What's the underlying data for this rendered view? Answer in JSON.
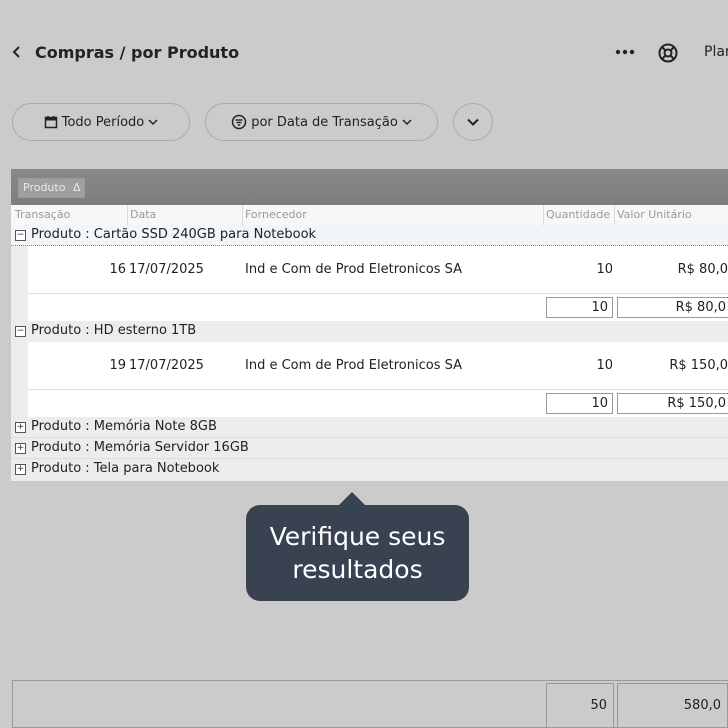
{
  "header": {
    "back_symbol": "‹",
    "title": "Compras / por Produto",
    "more_symbol": "•••",
    "plan_label": "Plan"
  },
  "filters": {
    "period_label": "Todo Período",
    "transaction_label": "por Data de Transação"
  },
  "grid": {
    "group_chip_label": "Produto",
    "group_chip_sort": "Δ",
    "columns": [
      "Transação",
      "Data",
      "Fornecedor",
      "Quantidade",
      "Valor Unitário"
    ],
    "groups": [
      {
        "label": "Produto : Cartão SSD 240GB para Notebook",
        "toggle": "−",
        "expanded": true,
        "rows": [
          {
            "transacao": "16",
            "data": "17/07/2025",
            "fornecedor": "Ind e Com de Prod Eletronicos SA",
            "quantidade": "10",
            "valor": "R$ 80,0"
          }
        ],
        "total_quantidade": "10",
        "total_valor": "R$ 80,0"
      },
      {
        "label": "Produto : HD esterno 1TB",
        "toggle": "−",
        "expanded": true,
        "rows": [
          {
            "transacao": "19",
            "data": "17/07/2025",
            "fornecedor": "Ind e Com de Prod Eletronicos SA",
            "quantidade": "10",
            "valor": "R$ 150,0"
          }
        ],
        "total_quantidade": "10",
        "total_valor": "R$ 150,0"
      },
      {
        "label": "Produto : Memória Note 8GB",
        "toggle": "+",
        "expanded": false
      },
      {
        "label": "Produto : Memória Servidor 16GB",
        "toggle": "+",
        "expanded": false
      },
      {
        "label": "Produto : Tela para Notebook",
        "toggle": "+",
        "expanded": false
      }
    ]
  },
  "tooltip": {
    "line1": "Verifique seus",
    "line2": "resultados"
  },
  "totals": {
    "quantidade": "50",
    "valor": "580,0"
  }
}
